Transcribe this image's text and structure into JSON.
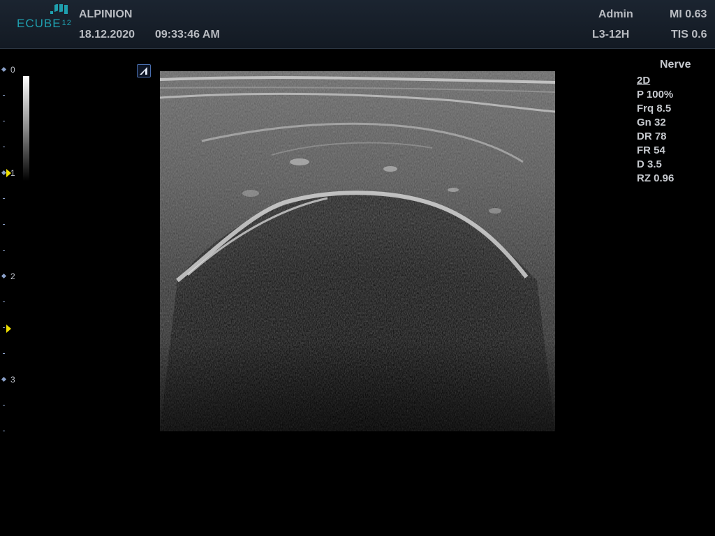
{
  "header": {
    "logo": {
      "text": "ECUBE",
      "model": "12"
    },
    "brand": "ALPINION",
    "date": "18.12.2020",
    "time": "09:33:46  AM",
    "user": "Admin",
    "probe": "L3-12H",
    "mi": "MI 0.63",
    "tis": "TIS 0.6"
  },
  "depth_scale": {
    "labels": [
      "0",
      "1",
      "2",
      "3"
    ],
    "focus_markers": 2,
    "marker_color": "#f0e000"
  },
  "orientation_marker": {
    "icon": "probe-orientation-icon"
  },
  "image": {
    "mode": "2D B-mode grayscale ultrasound"
  },
  "params": {
    "preset": "Nerve",
    "mode": "2D",
    "lines": [
      "P 100%",
      "Frq 8.5",
      "Gn 32",
      "DR 78",
      "FR 54",
      "D 3.5",
      "RZ 0.96"
    ]
  },
  "colors": {
    "background": "#000000",
    "header": "#1b2430",
    "logo": "#1f9fae",
    "text": "#c6c9ce",
    "scale": "#8aa0c8"
  }
}
